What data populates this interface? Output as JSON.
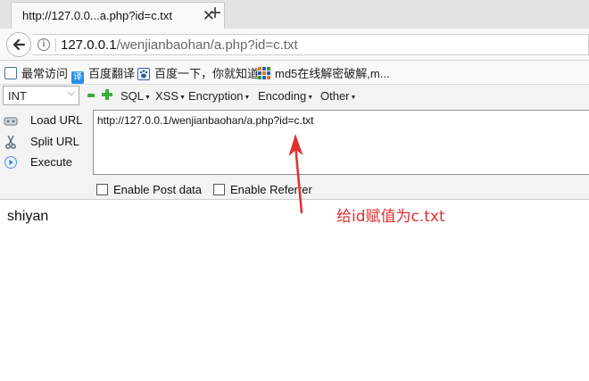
{
  "browser": {
    "tab": {
      "title": "http://127.0.0...a.php?id=c.txt",
      "close_glyph": "✕"
    },
    "new_tab_glyph": "+",
    "address": {
      "host": "127.0.0.1",
      "path": "/wenjianbaohan/a.php?id=c.txt"
    },
    "bookmarks": [
      {
        "label": "最常访问",
        "icon": "most-visited-icon"
      },
      {
        "label": "百度翻译",
        "icon": "translate-icon"
      },
      {
        "label": "百度一下，你就知道",
        "icon": "baidu-paw-icon"
      },
      {
        "label": "md5在线解密破解,m...",
        "icon": "grid-icon"
      }
    ]
  },
  "hackbar": {
    "select_value": "INT",
    "menus": [
      {
        "label": "SQL"
      },
      {
        "label": "XSS"
      },
      {
        "label": "Encryption"
      },
      {
        "label": "Encoding"
      },
      {
        "label": "Other"
      }
    ],
    "actions": {
      "load": "Load URL",
      "split": "Split URL",
      "execute": "Execute"
    },
    "url_value": "http://127.0.0.1/wenjianbaohan/a.php?id=c.txt",
    "options": {
      "post": "Enable Post data",
      "referrer": "Enable Referrer"
    }
  },
  "page": {
    "output": "shiyan",
    "annotation": "给id赋值为c.txt",
    "annotation_color": "#e03030"
  }
}
